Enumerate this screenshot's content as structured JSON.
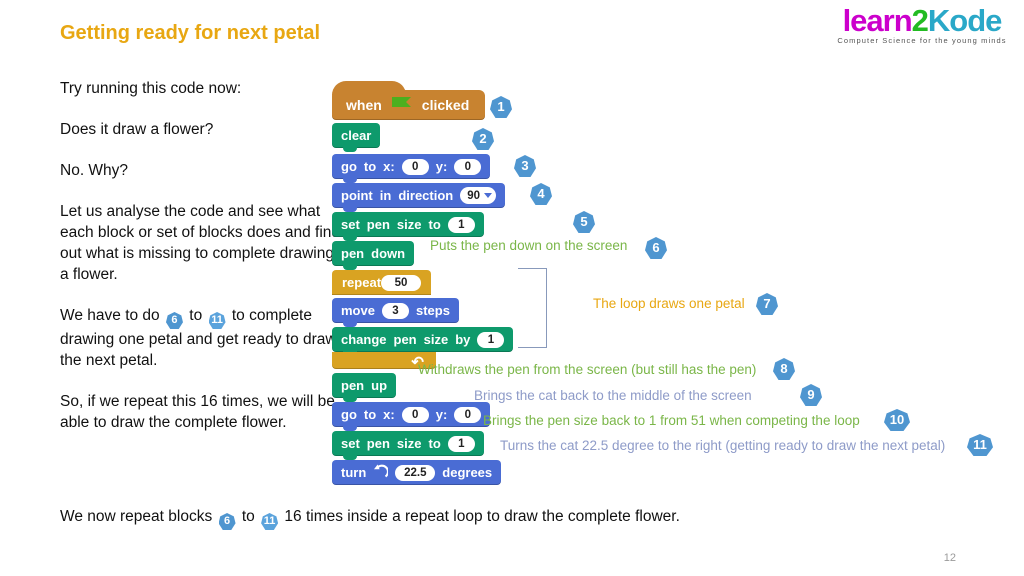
{
  "logo": {
    "part1": "learn",
    "part2": "2",
    "part3": "Kode",
    "tagline": "Computer Science for the young minds",
    "color1": "#cc00cc",
    "color2": "#22bb22",
    "color3": "#2aa8c8"
  },
  "title": "Getting ready for next petal",
  "title_color": "#e8a712",
  "body": {
    "p1": "Try running this code now:",
    "p2": "Does it draw a flower?",
    "p3": "No. Why?",
    "p4": "Let us analyse the code and see what each block or set of blocks does and find out what is missing to complete drawing a flower.",
    "p5_a": "We have to do",
    "p5_badge1": "6",
    "p5_b": "to",
    "p5_badge2": "11",
    "p5_c": "to complete drawing one petal and get ready to draw the next petal.",
    "p6": "So, if we repeat this 16 times, we will be able to draw the complete flower.",
    "p7_a": "We now repeat blocks",
    "p7_badge1": "6",
    "p7_b": "to",
    "p7_badge2": "11",
    "p7_c": "16 times inside a repeat loop to draw the complete flower."
  },
  "script": {
    "hat": {
      "word1": "when",
      "icon": "green-flag-icon",
      "word2": "clicked"
    },
    "clear": {
      "label": "clear"
    },
    "goto1": {
      "w1": "go",
      "w2": "to",
      "w3": "x:",
      "x": "0",
      "w4": "y:",
      "y": "0"
    },
    "point": {
      "w1": "point",
      "w2": "in",
      "w3": "direction",
      "value": "90"
    },
    "setpen1": {
      "w1": "set",
      "w2": "pen",
      "w3": "size",
      "w4": "to",
      "value": "1"
    },
    "pendown": {
      "w1": "pen",
      "w2": "down"
    },
    "repeat": {
      "label": "repeat",
      "times": "50"
    },
    "move": {
      "w1": "move",
      "steps": "3",
      "w2": "steps"
    },
    "changepen": {
      "w1": "change",
      "w2": "pen",
      "w3": "size",
      "w4": "by",
      "value": "1"
    },
    "penup": {
      "w1": "pen",
      "w2": "up"
    },
    "goto2": {
      "w1": "go",
      "w2": "to",
      "w3": "x:",
      "x": "0",
      "w4": "y:",
      "y": "0"
    },
    "setpen2": {
      "w1": "set",
      "w2": "pen",
      "w3": "size",
      "w4": "to",
      "value": "1"
    },
    "turn": {
      "w1": "turn",
      "icon": "turn-left-icon",
      "degrees": "22.5",
      "w2": "degrees"
    }
  },
  "markers": {
    "m1": "1",
    "m2": "2",
    "m3": "3",
    "m4": "4",
    "m5": "5",
    "m6": "6",
    "m7": "7",
    "m8": "8",
    "m9": "9",
    "m10": "10",
    "m11": "11"
  },
  "notes": {
    "n6": "Puts the pen down on the screen",
    "n7": "The loop draws one petal",
    "n8": "Withdraws the pen from the screen (but still has the pen)",
    "n9": "Brings the cat back to the middle of the screen",
    "n10": "Brings the pen size back to 1 from 51 when competing the loop",
    "n11": "Turns the cat 22.5 degree to the right (getting ready to draw the next petal)",
    "color_green": "#7ab648",
    "color_gold": "#e8a712",
    "color_blue": "#8e9bc8"
  },
  "page_number": "12"
}
